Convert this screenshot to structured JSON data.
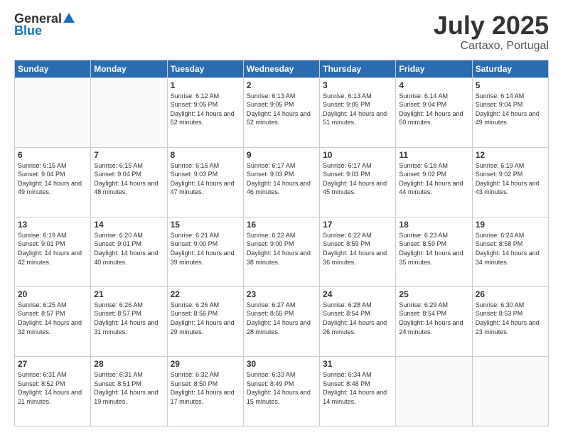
{
  "header": {
    "logo_general": "General",
    "logo_blue": "Blue",
    "title": "July 2025",
    "location": "Cartaxo, Portugal"
  },
  "days_of_week": [
    "Sunday",
    "Monday",
    "Tuesday",
    "Wednesday",
    "Thursday",
    "Friday",
    "Saturday"
  ],
  "weeks": [
    [
      {
        "day": "",
        "empty": true
      },
      {
        "day": "",
        "empty": true
      },
      {
        "day": "1",
        "sunrise": "6:12 AM",
        "sunset": "9:05 PM",
        "daylight": "14 hours and 52 minutes."
      },
      {
        "day": "2",
        "sunrise": "6:13 AM",
        "sunset": "9:05 PM",
        "daylight": "14 hours and 52 minutes."
      },
      {
        "day": "3",
        "sunrise": "6:13 AM",
        "sunset": "9:05 PM",
        "daylight": "14 hours and 51 minutes."
      },
      {
        "day": "4",
        "sunrise": "6:14 AM",
        "sunset": "9:04 PM",
        "daylight": "14 hours and 50 minutes."
      },
      {
        "day": "5",
        "sunrise": "6:14 AM",
        "sunset": "9:04 PM",
        "daylight": "14 hours and 49 minutes."
      }
    ],
    [
      {
        "day": "6",
        "sunrise": "6:15 AM",
        "sunset": "9:04 PM",
        "daylight": "14 hours and 49 minutes."
      },
      {
        "day": "7",
        "sunrise": "6:15 AM",
        "sunset": "9:04 PM",
        "daylight": "14 hours and 48 minutes."
      },
      {
        "day": "8",
        "sunrise": "6:16 AM",
        "sunset": "9:03 PM",
        "daylight": "14 hours and 47 minutes."
      },
      {
        "day": "9",
        "sunrise": "6:17 AM",
        "sunset": "9:03 PM",
        "daylight": "14 hours and 46 minutes."
      },
      {
        "day": "10",
        "sunrise": "6:17 AM",
        "sunset": "9:03 PM",
        "daylight": "14 hours and 45 minutes."
      },
      {
        "day": "11",
        "sunrise": "6:18 AM",
        "sunset": "9:02 PM",
        "daylight": "14 hours and 44 minutes."
      },
      {
        "day": "12",
        "sunrise": "6:19 AM",
        "sunset": "9:02 PM",
        "daylight": "14 hours and 43 minutes."
      }
    ],
    [
      {
        "day": "13",
        "sunrise": "6:19 AM",
        "sunset": "9:01 PM",
        "daylight": "14 hours and 42 minutes."
      },
      {
        "day": "14",
        "sunrise": "6:20 AM",
        "sunset": "9:01 PM",
        "daylight": "14 hours and 40 minutes."
      },
      {
        "day": "15",
        "sunrise": "6:21 AM",
        "sunset": "9:00 PM",
        "daylight": "14 hours and 39 minutes."
      },
      {
        "day": "16",
        "sunrise": "6:22 AM",
        "sunset": "9:00 PM",
        "daylight": "14 hours and 38 minutes."
      },
      {
        "day": "17",
        "sunrise": "6:22 AM",
        "sunset": "8:59 PM",
        "daylight": "14 hours and 36 minutes."
      },
      {
        "day": "18",
        "sunrise": "6:23 AM",
        "sunset": "8:59 PM",
        "daylight": "14 hours and 35 minutes."
      },
      {
        "day": "19",
        "sunrise": "6:24 AM",
        "sunset": "8:58 PM",
        "daylight": "14 hours and 34 minutes."
      }
    ],
    [
      {
        "day": "20",
        "sunrise": "6:25 AM",
        "sunset": "8:57 PM",
        "daylight": "14 hours and 32 minutes."
      },
      {
        "day": "21",
        "sunrise": "6:26 AM",
        "sunset": "8:57 PM",
        "daylight": "14 hours and 31 minutes."
      },
      {
        "day": "22",
        "sunrise": "6:26 AM",
        "sunset": "8:56 PM",
        "daylight": "14 hours and 29 minutes."
      },
      {
        "day": "23",
        "sunrise": "6:27 AM",
        "sunset": "8:55 PM",
        "daylight": "14 hours and 28 minutes."
      },
      {
        "day": "24",
        "sunrise": "6:28 AM",
        "sunset": "8:54 PM",
        "daylight": "14 hours and 26 minutes."
      },
      {
        "day": "25",
        "sunrise": "6:29 AM",
        "sunset": "8:54 PM",
        "daylight": "14 hours and 24 minutes."
      },
      {
        "day": "26",
        "sunrise": "6:30 AM",
        "sunset": "8:53 PM",
        "daylight": "14 hours and 23 minutes."
      }
    ],
    [
      {
        "day": "27",
        "sunrise": "6:31 AM",
        "sunset": "8:52 PM",
        "daylight": "14 hours and 21 minutes."
      },
      {
        "day": "28",
        "sunrise": "6:31 AM",
        "sunset": "8:51 PM",
        "daylight": "14 hours and 19 minutes."
      },
      {
        "day": "29",
        "sunrise": "6:32 AM",
        "sunset": "8:50 PM",
        "daylight": "14 hours and 17 minutes."
      },
      {
        "day": "30",
        "sunrise": "6:33 AM",
        "sunset": "8:49 PM",
        "daylight": "14 hours and 15 minutes."
      },
      {
        "day": "31",
        "sunrise": "6:34 AM",
        "sunset": "8:48 PM",
        "daylight": "14 hours and 14 minutes."
      },
      {
        "day": "",
        "empty": true
      },
      {
        "day": "",
        "empty": true
      }
    ]
  ]
}
